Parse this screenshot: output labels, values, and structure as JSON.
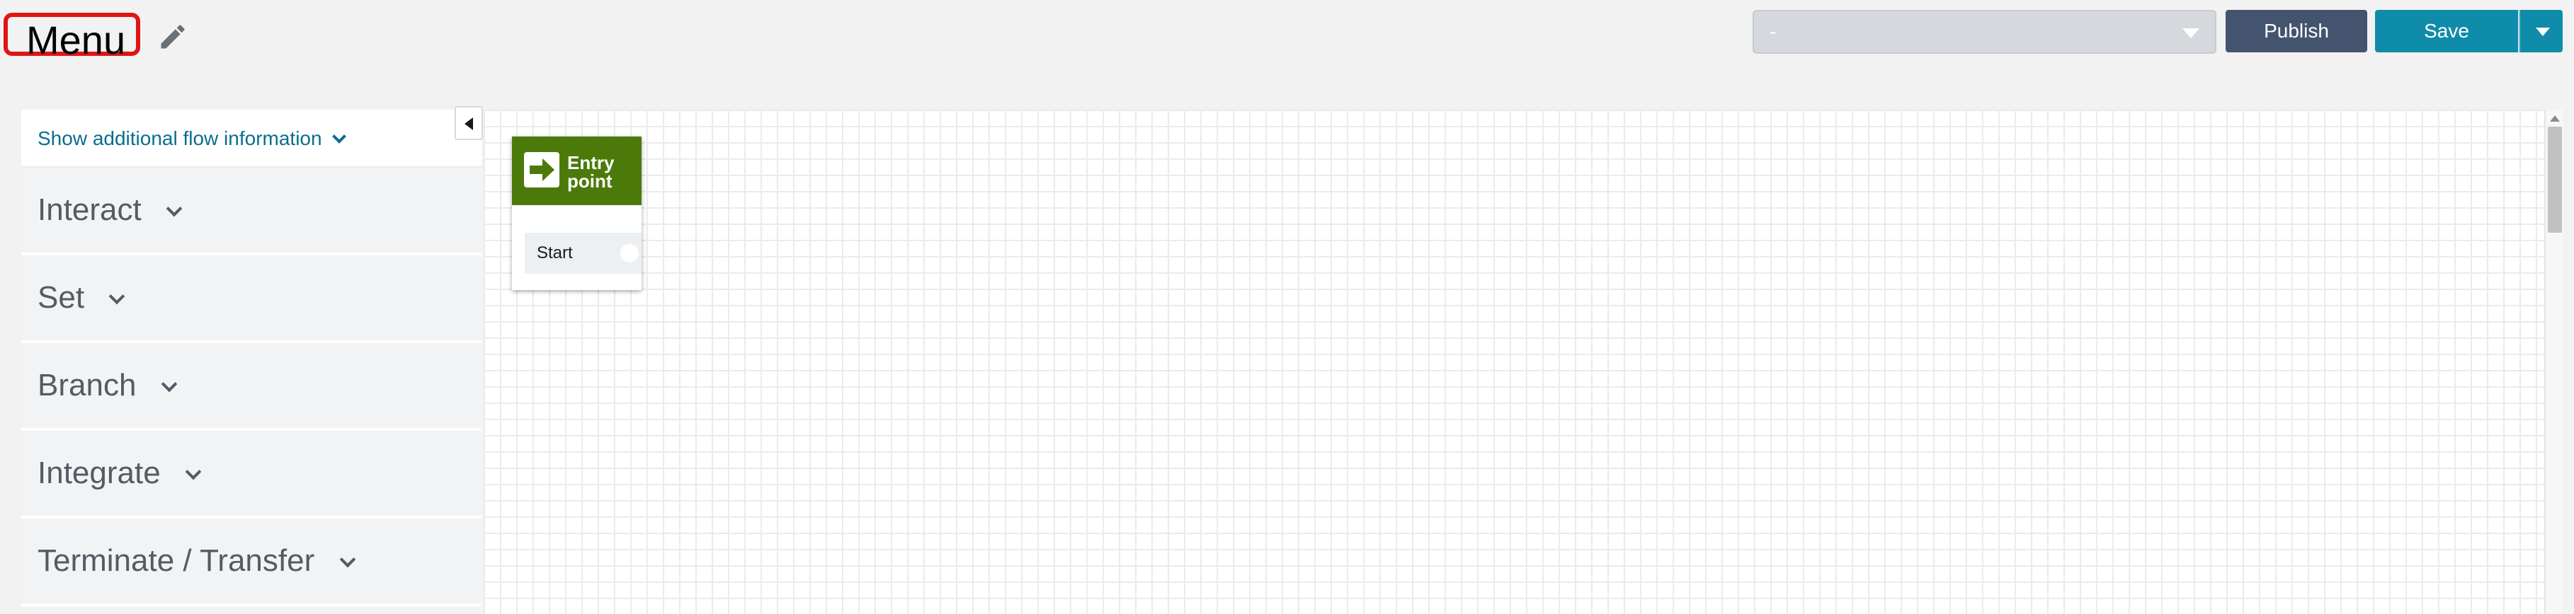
{
  "header": {
    "flow_title": "Menu",
    "flow_select_value": "-",
    "publish_label": "Publish",
    "save_label": "Save"
  },
  "palette": {
    "info_label": "Show additional flow information",
    "categories": [
      {
        "label": "Interact"
      },
      {
        "label": "Set"
      },
      {
        "label": "Branch"
      },
      {
        "label": "Integrate"
      },
      {
        "label": "Terminate / Transfer"
      }
    ]
  },
  "canvas": {
    "entry_block": {
      "title_line1": "Entry",
      "title_line2": "point",
      "branch_label": "Start",
      "header_color": "#4b7a0b"
    }
  },
  "colors": {
    "publish": "#44546f",
    "save": "#0f8ca9",
    "link": "#0a6e8c",
    "highlight_border": "#e01515"
  },
  "icons": [
    "pencil-icon",
    "chevron-down-icon",
    "caret-left-icon",
    "arrow-right-icon"
  ]
}
